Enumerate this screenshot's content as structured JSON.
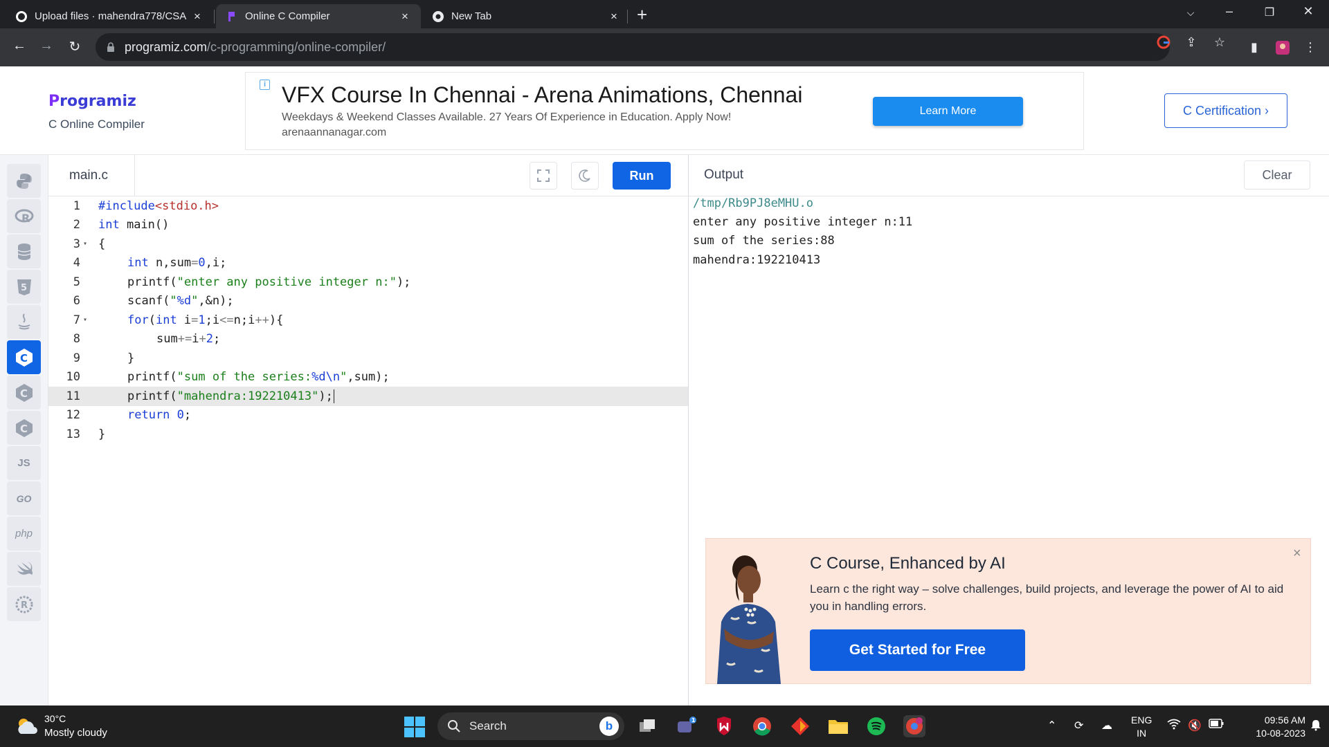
{
  "browser": {
    "tabs": [
      {
        "title": "Upload files · mahendra778/CSA"
      },
      {
        "title": "Online C Compiler"
      },
      {
        "title": "New Tab"
      }
    ],
    "url_main": "programiz.com",
    "url_rest": "/c-programming/online-compiler/"
  },
  "header": {
    "logo": "rogramiz",
    "logo_p": "P",
    "subtitle": "C Online Compiler",
    "ad": {
      "info": "i",
      "title": "VFX Course In Chennai - Arena Animations, Chennai",
      "description": "Weekdays & Weekend Classes Available. 27 Years Of Experience in Education. Apply Now!",
      "url": "arenaannanagar.com",
      "button": "Learn More"
    },
    "cert_button": "C Certification ›"
  },
  "rail": {
    "items": [
      {
        "icon": "python-icon",
        "glyph": "🐍"
      },
      {
        "icon": "r-icon",
        "glyph": "R"
      },
      {
        "icon": "sql-icon",
        "glyph": "≡"
      },
      {
        "icon": "html-icon",
        "glyph": "5"
      },
      {
        "icon": "java-icon",
        "glyph": "♨"
      },
      {
        "icon": "c-icon",
        "glyph": "C"
      },
      {
        "icon": "cpp-icon",
        "glyph": "C"
      },
      {
        "icon": "csharp-icon",
        "glyph": "C"
      },
      {
        "icon": "js-icon",
        "glyph": "JS"
      },
      {
        "icon": "go-icon",
        "glyph": "GO"
      },
      {
        "icon": "php-icon",
        "glyph": "php"
      },
      {
        "icon": "swift-icon",
        "glyph": "➶"
      },
      {
        "icon": "rust-icon",
        "glyph": "R"
      }
    ]
  },
  "editor": {
    "file_name": "main.c",
    "run_label": "Run",
    "lines": [
      {
        "n": "1",
        "fold": ""
      },
      {
        "n": "2",
        "fold": ""
      },
      {
        "n": "3",
        "fold": "▾"
      },
      {
        "n": "4",
        "fold": ""
      },
      {
        "n": "5",
        "fold": ""
      },
      {
        "n": "6",
        "fold": ""
      },
      {
        "n": "7",
        "fold": "▾"
      },
      {
        "n": "8",
        "fold": ""
      },
      {
        "n": "9",
        "fold": ""
      },
      {
        "n": "10",
        "fold": ""
      },
      {
        "n": "11",
        "fold": ""
      },
      {
        "n": "12",
        "fold": ""
      },
      {
        "n": "13",
        "fold": ""
      }
    ],
    "code": {
      "l1_pre": "#include",
      "l1_inc": "<stdio.h>",
      "l2_kw": "int",
      "l2_rest": " main()",
      "l3": "{",
      "l4_kw": "int",
      "l4_rest": " n,sum",
      "l4_eq": "=",
      "l4_num": "0",
      "l4_end": ",i;",
      "l5_fn": "printf(",
      "l5_str": "\"enter any positive integer n:\"",
      "l5_end": ");",
      "l6_fn": "scanf(",
      "l6_str1": "\"",
      "l6_fmt": "%d",
      "l6_str2": "\"",
      "l6_end": ",&n);",
      "l7_kw1": "for",
      "l7_p": "(",
      "l7_kw2": "int",
      "l7_a": " i",
      "l7_eq": "=",
      "l7_num": "1",
      "l7_b": ";i",
      "l7_le": "<=",
      "l7_c": "n;i",
      "l7_inc": "++",
      "l7_end": "){",
      "l8_a": "sum",
      "l8_op": "+=",
      "l8_b": "i",
      "l8_plus": "+",
      "l8_num": "2",
      "l8_end": ";",
      "l9": "}",
      "l10_fn": "printf(",
      "l10_str1": "\"sum of the series:",
      "l10_fmt": "%d\\n",
      "l10_str2": "\"",
      "l10_end": ",sum);",
      "l11_fn": "printf(",
      "l11_str": "\"mahendra:192210413\"",
      "l11_end": ");",
      "l12_kw": "return",
      "l12_num": " 0",
      "l12_end": ";",
      "l13": "}"
    }
  },
  "output": {
    "title": "Output",
    "clear_label": "Clear",
    "lines": [
      "/tmp/Rb9PJ8eMHU.o",
      "enter any positive integer n:11",
      "sum of the series:88",
      "mahendra:192210413"
    ]
  },
  "promo": {
    "title": "C Course, Enhanced by AI",
    "description": "Learn c the right way – solve challenges, build projects, and leverage the power of AI to aid you in handling errors.",
    "button": "Get Started for Free",
    "close": "×"
  },
  "taskbar": {
    "temperature": "30°C",
    "weather": "Mostly cloudy",
    "search": "Search",
    "lang1": "ENG",
    "lang2": "IN",
    "time": "09:56 AM",
    "date": "10-08-2023"
  },
  "colors": {
    "accent": "#1065e5",
    "ad_button": "#1a8cf0",
    "promo_bg": "#fde7dd"
  }
}
